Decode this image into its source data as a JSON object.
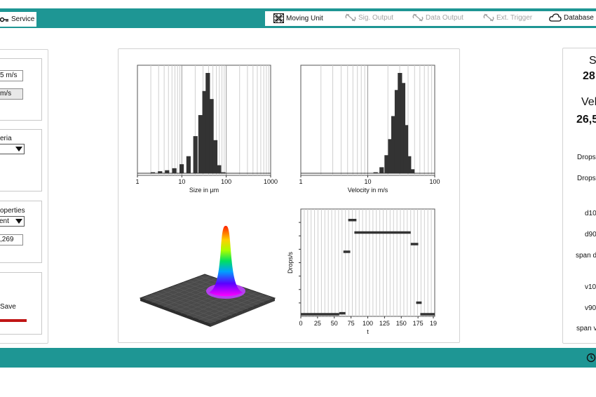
{
  "toolbar": {
    "service_label": "Service",
    "moving_unit_label": "Moving Unit",
    "sig_output_label": "Sig. Output",
    "data_output_label": "Data Output",
    "ext_trigger_label": "Ext. Trigger",
    "database_label": "Database"
  },
  "left_panel": {
    "field1_value": "5 m/s",
    "field2_value": "m/s",
    "criteria_label": "eria",
    "properties_label": "operties",
    "properties_select_value": "ent",
    "properties_field_value": ",269",
    "save_label": "Save"
  },
  "right_panel": {
    "size_title": "S",
    "size_value": "28",
    "velocity_title": "Vel",
    "velocity_value": "26,5",
    "row_labels": [
      "Drops",
      "Drops",
      "d10",
      "d90",
      "span d",
      "v10",
      "v90",
      "span v"
    ]
  },
  "chart_data": [
    {
      "type": "bar",
      "xlabel": "Size in µm",
      "x_scale": "log",
      "xlim": [
        1,
        1000
      ],
      "x_ticks": [
        "1",
        "10",
        "100",
        "1000"
      ],
      "grid": true,
      "bins": [
        {
          "x": 2.2,
          "h": 0.01
        },
        {
          "x": 3.2,
          "h": 0.02
        },
        {
          "x": 4.6,
          "h": 0.03
        },
        {
          "x": 6.7,
          "h": 0.05
        },
        {
          "x": 9.8,
          "h": 0.09
        },
        {
          "x": 14,
          "h": 0.17
        },
        {
          "x": 20,
          "h": 0.37
        },
        {
          "x": 26,
          "h": 0.58
        },
        {
          "x": 32,
          "h": 0.82
        },
        {
          "x": 38,
          "h": 1.0
        },
        {
          "x": 46,
          "h": 0.74
        },
        {
          "x": 56,
          "h": 0.33
        },
        {
          "x": 68,
          "h": 0.08
        },
        {
          "x": 85,
          "h": 0.01
        }
      ]
    },
    {
      "type": "bar",
      "xlabel": "Velocity in m/s",
      "x_scale": "log",
      "xlim": [
        1,
        100
      ],
      "x_ticks": [
        "1",
        "10",
        "100"
      ],
      "grid": true,
      "bins": [
        {
          "x": 13,
          "h": 0.01
        },
        {
          "x": 16,
          "h": 0.06
        },
        {
          "x": 19,
          "h": 0.18
        },
        {
          "x": 21.5,
          "h": 0.34
        },
        {
          "x": 24,
          "h": 0.57
        },
        {
          "x": 27,
          "h": 0.83
        },
        {
          "x": 30,
          "h": 1.0
        },
        {
          "x": 33.5,
          "h": 0.9
        },
        {
          "x": 37,
          "h": 0.48
        },
        {
          "x": 41,
          "h": 0.17
        },
        {
          "x": 46,
          "h": 0.04
        }
      ]
    },
    {
      "type": "line",
      "xlabel": "t",
      "ylabel": "Drops/s",
      "xlim": [
        0,
        195
      ],
      "x_ticks": [
        "0",
        "25",
        "50",
        "75",
        "100",
        "125",
        "150",
        "175",
        "19"
      ],
      "grid": true,
      "segments": [
        {
          "x0": 0,
          "x1": 56,
          "y": 0.0
        },
        {
          "x0": 56,
          "x1": 65,
          "y": 0.01
        },
        {
          "x0": 62,
          "x1": 72,
          "y": 0.65
        },
        {
          "x0": 69,
          "x1": 81,
          "y": 0.98
        },
        {
          "x0": 78,
          "x1": 160,
          "y": 0.85
        },
        {
          "x0": 160,
          "x1": 171,
          "y": 0.73
        },
        {
          "x0": 168,
          "x1": 176,
          "y": 0.12
        },
        {
          "x0": 174,
          "x1": 195,
          "y": 0.0
        }
      ]
    }
  ]
}
